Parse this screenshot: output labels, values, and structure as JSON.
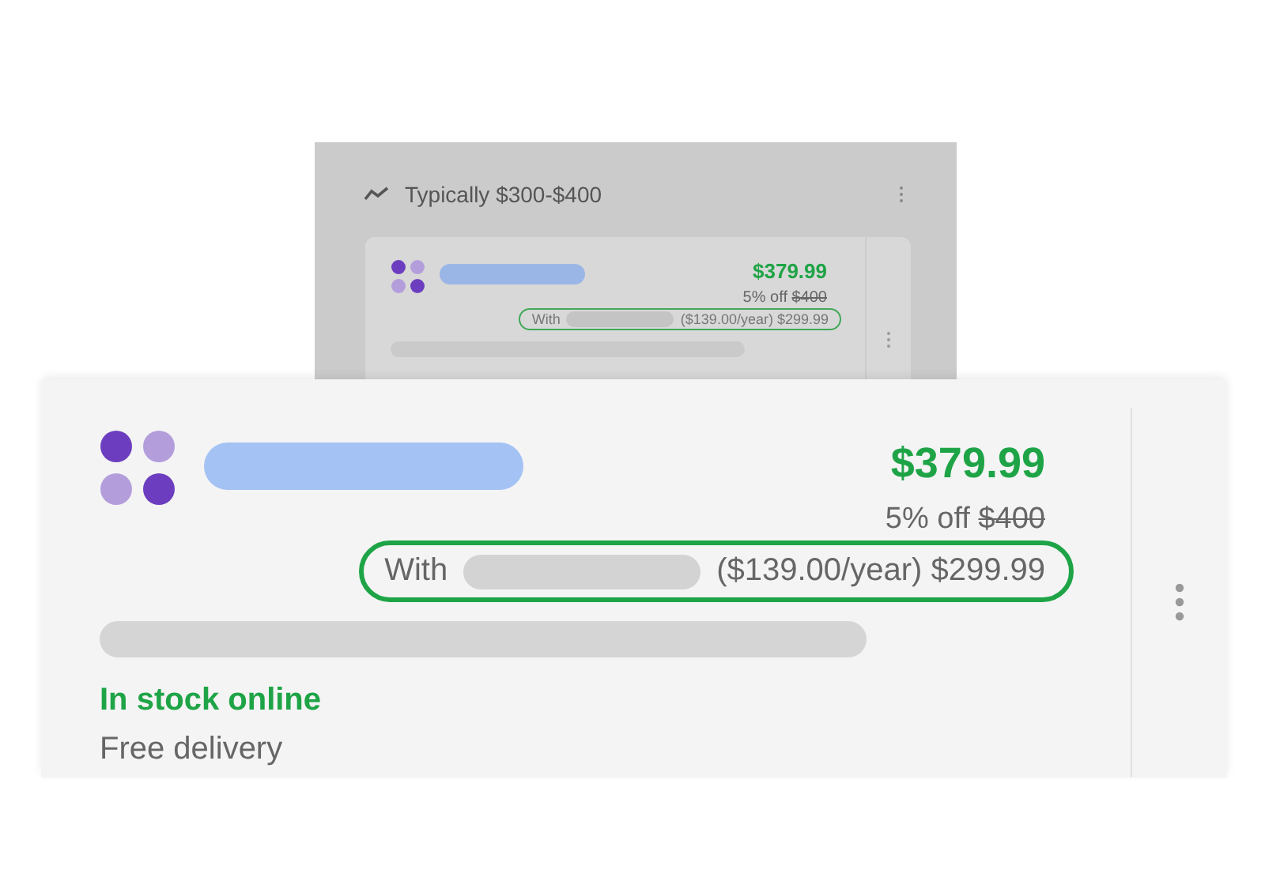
{
  "back_panel": {
    "summary": "Typically $300-$400",
    "listing": {
      "price": "$379.99",
      "discount": "5% off",
      "original_price": "$400",
      "membership": {
        "prefix": "With",
        "details": "($139.00/year) $299.99",
        "highlighted": true
      }
    }
  },
  "listing": {
    "price": "$379.99",
    "discount": "5% off",
    "original_price": "$400",
    "membership": {
      "prefix": "With",
      "details": "($139.00/year) $299.99",
      "highlighted": true
    },
    "availability": "In stock online",
    "delivery": "Free delivery"
  }
}
